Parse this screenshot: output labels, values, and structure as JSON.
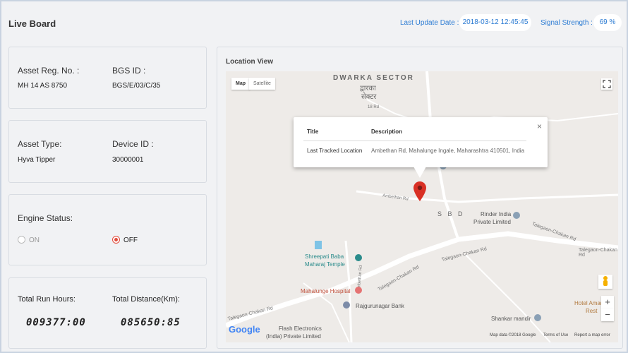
{
  "header": {
    "title": "Live Board",
    "last_update_label": "Last Update Date :",
    "last_update_value": "2018-03-12 12:45:45",
    "signal_label": "Signal Strength :",
    "signal_value": "69 %"
  },
  "asset": {
    "reg_label": "Asset Reg. No. :",
    "reg_value": "MH 14 AS 8750",
    "bgs_label": "BGS ID :",
    "bgs_value": "BGS/E/03/C/35",
    "type_label": "Asset Type:",
    "type_value": "Hyva Tipper",
    "device_label": "Device ID :",
    "device_value": "30000001"
  },
  "engine": {
    "label": "Engine Status:",
    "on_label": "ON",
    "off_label": "OFF",
    "selected": "OFF"
  },
  "totals": {
    "run_hours_label": "Total Run Hours:",
    "run_hours_value": "009377:00",
    "distance_label": "Total Distance(Km):",
    "distance_value": "085650:85"
  },
  "map": {
    "section_title": "Location View",
    "type_map": "Map",
    "type_satellite": "Satellite",
    "popup": {
      "col_title": "Title",
      "col_desc": "Description",
      "row_title": "Last Tracked Location",
      "row_desc": "Ambethan Rd, Mahalunge Ingale, Maharashtra 410501, India"
    },
    "labels": {
      "dwarka": "DWARKA SECTOR",
      "dwarka_hi": "द्वारका",
      "dwarka_hi2": "सेक्टर",
      "road_18": "18 Rd",
      "ambethan": "Ambethan Rd",
      "sbd": "S B D",
      "rinder1": "Rinder India",
      "rinder2": "Private Limited",
      "talegaon1": "Talegaon-Chakan Rd",
      "talegaon2": "Talegaon-Chakan Rd",
      "talegaon3": "Talegaon-Chakan Rd",
      "talegaon4": "Talegaon-Chakan Rd",
      "talegaon5": "Talegaon-Chakan Rd",
      "shreepati1": "Shreepati Baba",
      "shreepati2": "Maharaj Temple",
      "ambethan_v": "Ambethan Rd",
      "mahalunge": "Mahalunge Hospital",
      "rajgurunagar": "Rajgurunagar Bank",
      "shankar": "Shankar mandir",
      "hotel1": "Hotel Amaurity",
      "hotel2": "Rest",
      "flash1": "Flash Electronics",
      "flash2": "(India) Private Limited",
      "google": "Google"
    },
    "footer": {
      "map_data": "Map data ©2018 Google",
      "terms": "Terms of Use",
      "report": "Report a map error"
    },
    "zoom_in": "+",
    "zoom_out": "−"
  }
}
